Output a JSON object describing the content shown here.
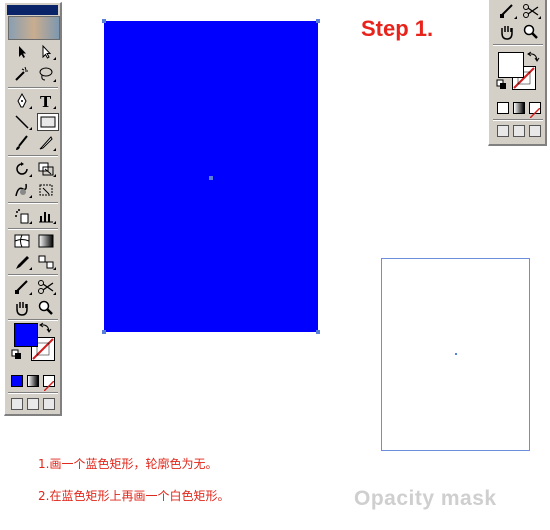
{
  "header": {
    "step_title": "Step 1."
  },
  "instructions": {
    "line1": "1.画一个蓝色矩形，轮廓色为无。",
    "line2": "2.在蓝色矩形上再画一个白色矩形。"
  },
  "watermark": "Opacity mask",
  "colors": {
    "fill": "#0000ff",
    "stroke": "#ffffff",
    "white_rect_border": "#6d8fd9",
    "title_red": "#e8231b",
    "instruction_red": "#e0261a"
  },
  "toolbox": {
    "tools": [
      "selection-tool",
      "direct-selection-tool",
      "magic-wand-tool",
      "lasso-tool",
      "pen-tool",
      "type-tool",
      "line-tool",
      "rectangle-tool",
      "paintbrush-tool",
      "pencil-tool",
      "rotate-tool",
      "scale-tool",
      "warp-tool",
      "free-transform-tool",
      "symbol-sprayer-tool",
      "column-graph-tool",
      "mesh-tool",
      "gradient-tool",
      "eyedropper-tool",
      "blend-tool",
      "slice-tool",
      "scissors-tool",
      "hand-tool",
      "zoom-tool"
    ],
    "active_tool": "rectangle-tool"
  }
}
